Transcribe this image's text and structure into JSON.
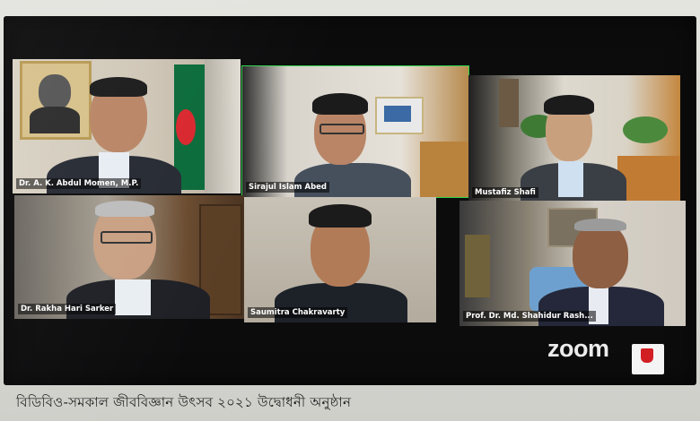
{
  "participants": [
    {
      "name": "Dr. A. K. Abdul Momen, M.P.",
      "active": false
    },
    {
      "name": "Sirajul Islam Abed",
      "active": true
    },
    {
      "name": "Mustafiz Shafi",
      "active": false
    },
    {
      "name": "Dr. Rakha Hari Sarker",
      "active": false
    },
    {
      "name": "Saumitra Chakravarty",
      "active": false
    },
    {
      "name": "Prof. Dr. Md. Shahidur Rash...",
      "active": false
    }
  ],
  "app": {
    "logo": "zoom"
  },
  "colors": {
    "active_speaker": "#2fd44a",
    "screen_bg": "#0c0c0d",
    "badge_red": "#d21f24"
  },
  "caption": "বিডিবিও-সমকাল জীববিজ্ঞান উৎসব ২০২১ উদ্বোধনী অনুষ্ঠান"
}
